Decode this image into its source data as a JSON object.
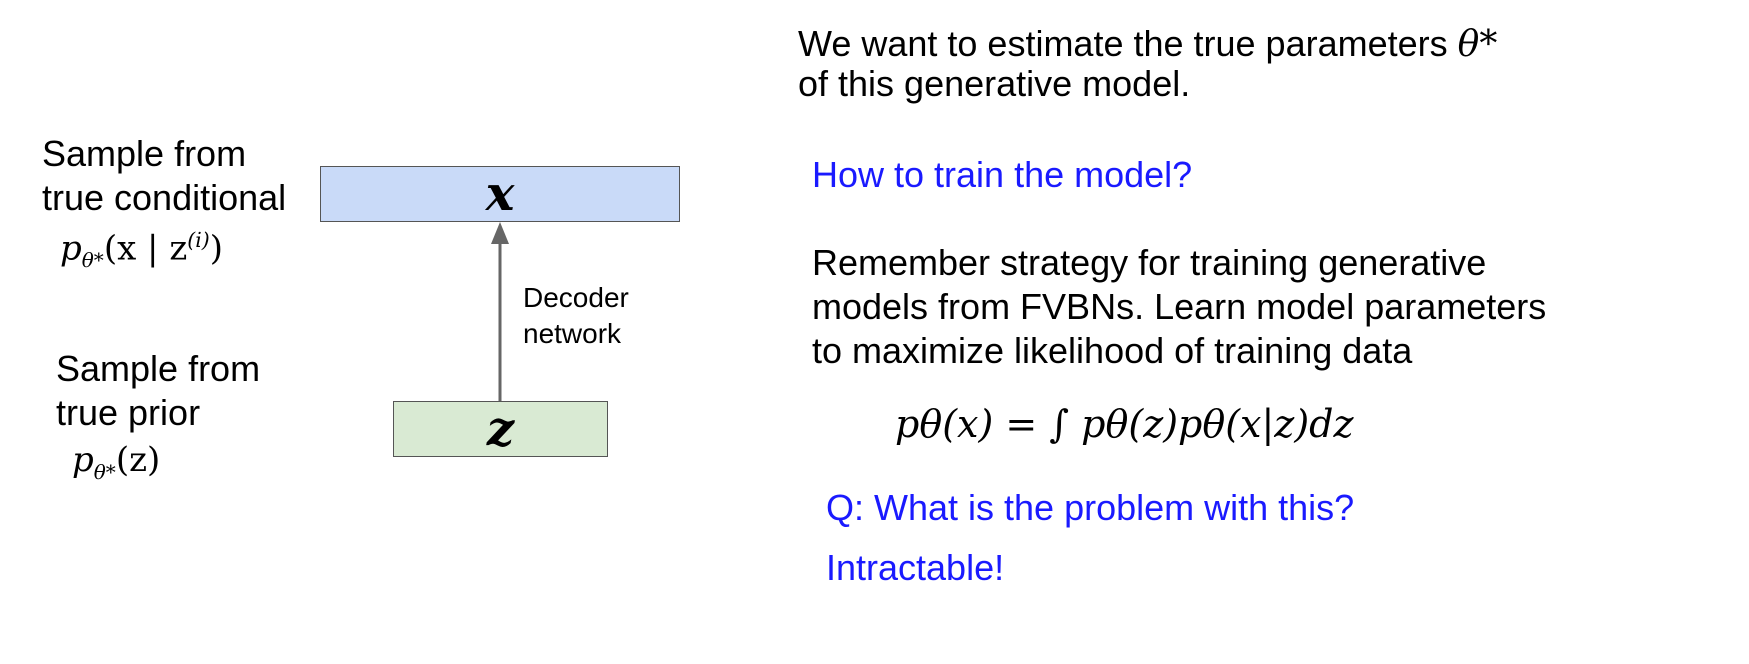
{
  "left": {
    "label_conditional_line1": "Sample from",
    "label_conditional_line2": "true conditional",
    "formula_conditional_base": "p",
    "formula_conditional_sub": "θ*",
    "formula_conditional_args": "(x | z",
    "formula_conditional_sup": "(i)",
    "formula_conditional_close": ")",
    "label_prior_line1": "Sample from",
    "label_prior_line2": "true prior",
    "formula_prior_base": "p",
    "formula_prior_sub": "θ*",
    "formula_prior_args": "(z)"
  },
  "diagram": {
    "box_x_label": "x",
    "box_z_label": "z",
    "arrow_label_line1": "Decoder",
    "arrow_label_line2": "network",
    "colors": {
      "box_x": "#c9daf8",
      "box_z": "#d9ead3",
      "arrow": "#666666"
    }
  },
  "right": {
    "intro_line1_text": "We want to estimate the true parameters ",
    "intro_line1_theta": "θ*",
    "intro_line2": "of this generative model.",
    "question1": "How to train the model?",
    "strategy_line1": "Remember strategy for training generative",
    "strategy_line2": "models from FVBNs. Learn model parameters",
    "strategy_line3": "to maximize likelihood of training data",
    "likelihood_formula": "pθ(x) = ∫ pθ(z)pθ(x|z)dz",
    "question2": "Q: What is the problem with this?",
    "answer": "Intractable!",
    "colors": {
      "highlight": "#1a1aff"
    }
  }
}
